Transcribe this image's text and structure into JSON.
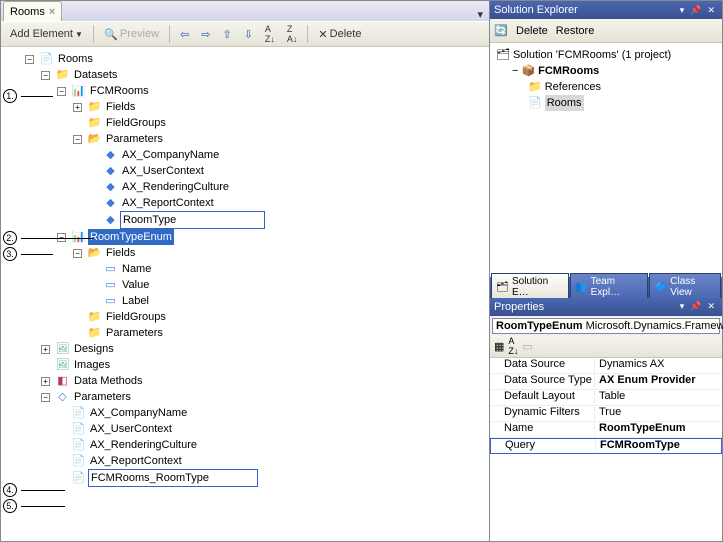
{
  "left": {
    "tab_label": "Rooms",
    "toolbar": {
      "add_element": "Add Element",
      "preview": "Preview",
      "delete": "Delete"
    },
    "tree": {
      "root": "Rooms",
      "datasets": "Datasets",
      "fcmrooms": "FCMRooms",
      "fields": "Fields",
      "fieldgroups": "FieldGroups",
      "parameters": "Parameters",
      "ax_company": "AX_CompanyName",
      "ax_user": "AX_UserContext",
      "ax_culture": "AX_RenderingCulture",
      "ax_report": "AX_ReportContext",
      "roomtype": "RoomType",
      "roomtypeenum": "RoomTypeEnum",
      "fields2": "Fields",
      "name": "Name",
      "value": "Value",
      "label": "Label",
      "designs": "Designs",
      "images": "Images",
      "datamethods": "Data Methods",
      "parameters2": "Parameters",
      "p_ax_company": "AX_CompanyName",
      "p_ax_user": "AX_UserContext",
      "p_ax_culture": "AX_RenderingCulture",
      "p_ax_report": "AX_ReportContext",
      "p_room": "FCMRooms_RoomType"
    }
  },
  "right": {
    "se_title": "Solution Explorer",
    "se_toolbar": {
      "delete": "Delete",
      "restore": "Restore"
    },
    "se_tree": {
      "solution": "Solution 'FCMRooms' (1 project)",
      "project": "FCMRooms",
      "refs": "References",
      "rooms": "Rooms"
    },
    "tabs": {
      "se": "Solution E…",
      "team": "Team Expl…",
      "cls": "Class View"
    },
    "props": {
      "title": "Properties",
      "obj_name": "RoomTypeEnum",
      "obj_type": "Microsoft.Dynamics.Framew",
      "grid": {
        "dsLabel": "Data Source",
        "dsVal": "Dynamics AX",
        "dstLabel": "Data Source Type",
        "dstVal": "AX Enum Provider",
        "dlLabel": "Default Layout",
        "dlVal": "Table",
        "dfLabel": "Dynamic Filters",
        "dfVal": "True",
        "nLabel": "Name",
        "nVal": "RoomTypeEnum",
        "qLabel": "Query",
        "qVal": "FCMRoomType"
      }
    }
  }
}
